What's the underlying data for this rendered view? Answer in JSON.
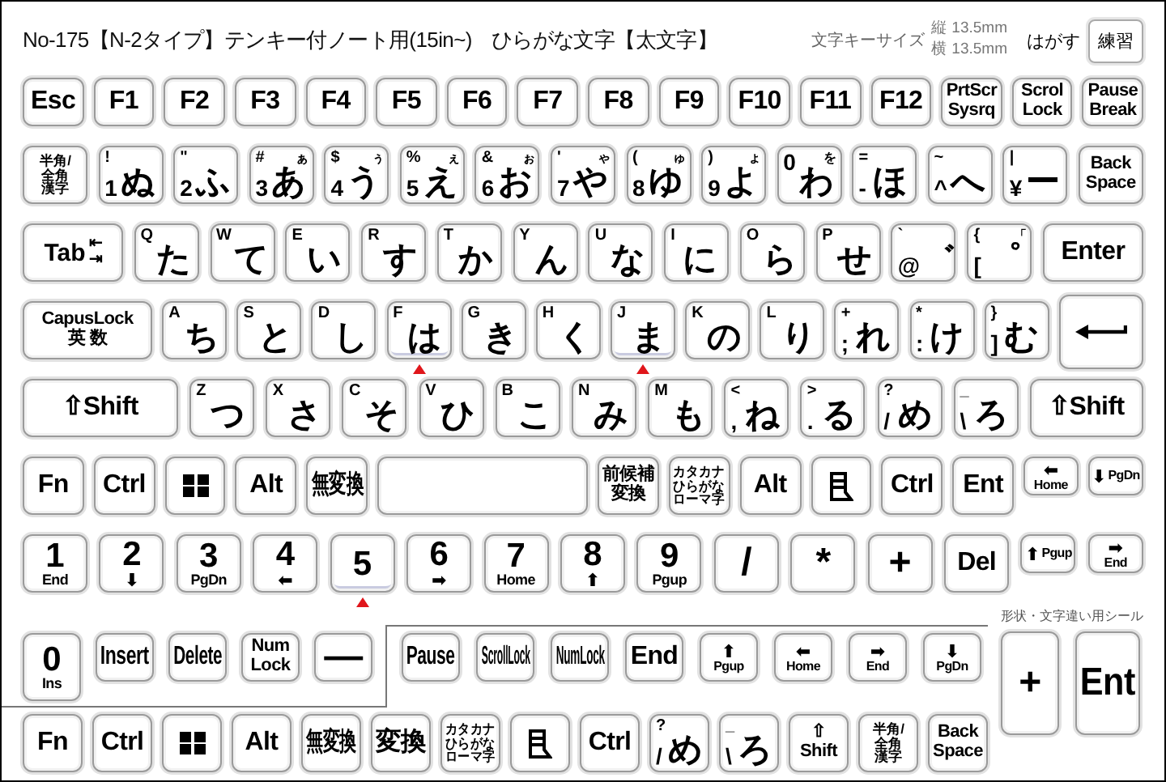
{
  "header": {
    "title": "No-175【N-2タイプ】テンキー付ノート用(15in~)",
    "subtitle": "ひらがな文字【太文字】",
    "size_label": "文字キーサイズ",
    "size_values": [
      "縦 13.5mm",
      "横 13.5mm"
    ],
    "peel_label": "はがす",
    "practice_tag": "練習"
  },
  "rows": [
    [
      {
        "kind": "text",
        "lines": [
          "Esc"
        ],
        "homing": false
      },
      {
        "kind": "text",
        "lines": [
          "F1"
        ],
        "homing": false
      },
      {
        "kind": "text",
        "lines": [
          "F2"
        ],
        "homing": false
      },
      {
        "kind": "text",
        "lines": [
          "F3"
        ],
        "homing": false
      },
      {
        "kind": "text",
        "lines": [
          "F4"
        ],
        "homing": false
      },
      {
        "kind": "text",
        "lines": [
          "F5"
        ],
        "homing": false
      },
      {
        "kind": "text",
        "lines": [
          "F6"
        ],
        "homing": false
      },
      {
        "kind": "text",
        "lines": [
          "F7"
        ],
        "homing": false
      },
      {
        "kind": "text",
        "lines": [
          "F8"
        ],
        "homing": false
      },
      {
        "kind": "text",
        "lines": [
          "F9"
        ],
        "homing": false
      },
      {
        "kind": "text",
        "lines": [
          "F10"
        ],
        "homing": false
      },
      {
        "kind": "text",
        "lines": [
          "F11"
        ],
        "homing": false
      },
      {
        "kind": "text",
        "lines": [
          "F12"
        ],
        "homing": false
      },
      {
        "kind": "text",
        "lines": [
          "PrtScr",
          "Sysrq"
        ],
        "homing": false
      },
      {
        "kind": "text",
        "lines": [
          "Scrol",
          "Lock"
        ],
        "homing": false
      },
      {
        "kind": "text",
        "lines": [
          "Pause",
          "Break"
        ],
        "homing": false
      }
    ],
    [
      {
        "kind": "text",
        "lines": [
          "半角/",
          "全角",
          "漢字"
        ],
        "homing": false
      },
      {
        "kind": "kana",
        "tl": "!",
        "bl": "1",
        "main": "ぬ",
        "homing": false
      },
      {
        "kind": "kana",
        "tl": "\"",
        "bl": "2",
        "main": "ふ",
        "homing": false
      },
      {
        "kind": "kana",
        "tl": "#",
        "bl": "3",
        "tr": "ぁ",
        "main": "あ",
        "homing": false
      },
      {
        "kind": "kana",
        "tl": "$",
        "bl": "4",
        "tr": "ぅ",
        "main": "う",
        "homing": false
      },
      {
        "kind": "kana",
        "tl": "%",
        "bl": "5",
        "tr": "ぇ",
        "main": "え",
        "homing": false
      },
      {
        "kind": "kana",
        "tl": "&",
        "bl": "6",
        "tr": "ぉ",
        "main": "お",
        "homing": false
      },
      {
        "kind": "kana",
        "tl": "'",
        "bl": "7",
        "tr": "ゃ",
        "main": "や",
        "homing": false
      },
      {
        "kind": "kana",
        "tl": "(",
        "bl": "8",
        "tr": "ゅ",
        "main": "ゆ",
        "homing": false
      },
      {
        "kind": "kana",
        "tl": ")",
        "bl": "9",
        "tr": "ょ",
        "main": "よ",
        "homing": false
      },
      {
        "kind": "kana",
        "bl": "0",
        "tr": "を",
        "main": "わ",
        "homing": false
      },
      {
        "kind": "kana",
        "tl": "=",
        "bl": "-",
        "main": "ほ",
        "homing": false
      },
      {
        "kind": "kana",
        "tl": "~",
        "bl": "^",
        "main": "へ",
        "homing": false
      },
      {
        "kind": "kana",
        "tl": "|",
        "bl": "¥",
        "main": "ー",
        "homing": false
      },
      {
        "kind": "text",
        "lines": [
          "Back",
          "Space"
        ],
        "homing": false
      }
    ],
    [
      {
        "kind": "tab",
        "main": "Tab",
        "tr": "⇤",
        "br": "⇥",
        "homing": false
      },
      {
        "kind": "kana",
        "tl": "Q",
        "main": "た",
        "homing": false
      },
      {
        "kind": "kana",
        "tl": "W",
        "main": "て",
        "homing": false
      },
      {
        "kind": "kana",
        "tl": "E",
        "main": "い",
        "homing": false
      },
      {
        "kind": "kana",
        "tl": "R",
        "main": "す",
        "homing": false
      },
      {
        "kind": "kana",
        "tl": "T",
        "main": "か",
        "homing": false
      },
      {
        "kind": "kana",
        "tl": "Y",
        "main": "ん",
        "homing": false
      },
      {
        "kind": "kana",
        "tl": "U",
        "main": "な",
        "homing": false
      },
      {
        "kind": "kana",
        "tl": "I",
        "main": "に",
        "homing": false
      },
      {
        "kind": "kana",
        "tl": "O",
        "main": "ら",
        "homing": false
      },
      {
        "kind": "kana",
        "tl": "P",
        "main": "せ",
        "homing": false
      },
      {
        "kind": "kana",
        "tl": "`",
        "bl": "@",
        "main": "゛",
        "homing": false
      },
      {
        "kind": "kana",
        "tl": "{",
        "bl": "[",
        "tr": "「",
        "main": "゜",
        "homing": false
      },
      {
        "kind": "text",
        "lines": [
          "Enter"
        ],
        "homing": false
      }
    ],
    [
      {
        "kind": "text",
        "lines": [
          "CapusLock",
          "英 数"
        ],
        "homing": false
      },
      {
        "kind": "kana",
        "tl": "A",
        "main": "ち",
        "homing": false
      },
      {
        "kind": "kana",
        "tl": "S",
        "main": "と",
        "homing": false
      },
      {
        "kind": "kana",
        "tl": "D",
        "main": "し",
        "homing": false
      },
      {
        "kind": "kana",
        "tl": "F",
        "main": "は",
        "homing": true
      },
      {
        "kind": "kana",
        "tl": "G",
        "main": "き",
        "homing": false
      },
      {
        "kind": "kana",
        "tl": "H",
        "main": "く",
        "homing": false
      },
      {
        "kind": "kana",
        "tl": "J",
        "main": "ま",
        "homing": true
      },
      {
        "kind": "kana",
        "tl": "K",
        "main": "の",
        "homing": false
      },
      {
        "kind": "kana",
        "tl": "L",
        "main": "り",
        "homing": false
      },
      {
        "kind": "kana",
        "tl": "+",
        "bl": ";",
        "main": "れ",
        "homing": false
      },
      {
        "kind": "kana",
        "tl": "*",
        "bl": ":",
        "main": "け",
        "homing": false
      },
      {
        "kind": "kana",
        "tl": "}",
        "bl": "]",
        "main": "む",
        "homing": false
      },
      {
        "kind": "return",
        "homing": false
      }
    ],
    [
      {
        "kind": "text",
        "lines": [
          "⇧Shift"
        ],
        "homing": false
      },
      {
        "kind": "kana",
        "tl": "Z",
        "main": "つ",
        "homing": false
      },
      {
        "kind": "kana",
        "tl": "X",
        "main": "さ",
        "homing": false
      },
      {
        "kind": "kana",
        "tl": "C",
        "main": "そ",
        "homing": false
      },
      {
        "kind": "kana",
        "tl": "V",
        "main": "ひ",
        "homing": false
      },
      {
        "kind": "kana",
        "tl": "B",
        "main": "こ",
        "homing": false
      },
      {
        "kind": "kana",
        "tl": "N",
        "main": "み",
        "homing": false
      },
      {
        "kind": "kana",
        "tl": "M",
        "main": "も",
        "homing": false
      },
      {
        "kind": "kana",
        "tl": "<",
        "bl": ",",
        "main": "ね",
        "homing": false
      },
      {
        "kind": "kana",
        "tl": ">",
        "bl": ".",
        "main": "る",
        "homing": false
      },
      {
        "kind": "kana",
        "tl": "?",
        "bl": "/",
        "main": "め",
        "homing": false
      },
      {
        "kind": "kana",
        "tl": "_",
        "bl": "\\",
        "main": "ろ",
        "homing": false
      },
      {
        "kind": "text",
        "lines": [
          "⇧Shift"
        ],
        "homing": false
      }
    ],
    [
      {
        "kind": "text",
        "lines": [
          "Fn"
        ],
        "homing": false
      },
      {
        "kind": "text",
        "lines": [
          "Ctrl"
        ],
        "homing": false
      },
      {
        "kind": "windows",
        "homing": false
      },
      {
        "kind": "text",
        "lines": [
          "Alt"
        ],
        "homing": false
      },
      {
        "kind": "text",
        "lines": [
          "無変換"
        ],
        "homing": false
      },
      {
        "kind": "blank",
        "homing": false
      },
      {
        "kind": "text",
        "lines": [
          "前候補",
          "変換"
        ],
        "homing": false
      },
      {
        "kind": "text",
        "lines": [
          "カタカナ",
          "ひらがな",
          "ローマ字"
        ],
        "homing": false
      },
      {
        "kind": "text",
        "lines": [
          "Alt"
        ],
        "homing": false
      },
      {
        "kind": "menu",
        "homing": false
      },
      {
        "kind": "text",
        "lines": [
          "Ctrl"
        ],
        "homing": false
      },
      {
        "kind": "text",
        "lines": [
          "Ent"
        ],
        "homing": false
      },
      {
        "kind": "arrow",
        "arrow": "⬅",
        "label": "Home",
        "homing": false
      },
      {
        "kind": "arrowrow",
        "arrow": "⬇",
        "label": "PgDn",
        "homing": false
      }
    ],
    [
      {
        "kind": "num",
        "main": "1",
        "sub": "End",
        "homing": false
      },
      {
        "kind": "num",
        "main": "2",
        "arrow": "⬇",
        "homing": false
      },
      {
        "kind": "num",
        "main": "3",
        "sub": "PgDn",
        "homing": false
      },
      {
        "kind": "num",
        "main": "4",
        "arrow": "⬅",
        "homing": false
      },
      {
        "kind": "num",
        "main": "5",
        "homing": true
      },
      {
        "kind": "num",
        "main": "6",
        "arrow": "➡",
        "homing": false
      },
      {
        "kind": "num",
        "main": "7",
        "sub": "Home",
        "homing": false
      },
      {
        "kind": "num",
        "main": "8",
        "arrow": "⬆",
        "homing": false
      },
      {
        "kind": "num",
        "main": "9",
        "sub": "Pgup",
        "homing": false
      },
      {
        "kind": "text",
        "lines": [
          "/"
        ],
        "homing": false
      },
      {
        "kind": "text",
        "lines": [
          "*"
        ],
        "homing": false
      },
      {
        "kind": "text",
        "lines": [
          "+"
        ],
        "homing": false
      },
      {
        "kind": "text",
        "lines": [
          "Del"
        ],
        "homing": false
      },
      {
        "kind": "arrowrow",
        "arrow": "⬆",
        "label": "Pgup",
        "homing": false
      },
      {
        "kind": "arrow",
        "arrow": "➡",
        "label": "End",
        "homing": false
      }
    ]
  ],
  "cut_block": {
    "inner_keys": [
      {
        "kind": "num",
        "main": "0",
        "sub": "Ins",
        "homing": false
      },
      {
        "kind": "text",
        "lines": [
          "Insert"
        ],
        "homing": false
      },
      {
        "kind": "text",
        "lines": [
          "Delete"
        ],
        "homing": false
      },
      {
        "kind": "text",
        "lines": [
          "Num",
          "Lock"
        ],
        "homing": false
      },
      {
        "kind": "text",
        "lines": [
          "—"
        ],
        "homing": false
      }
    ],
    "outer_keys": [
      {
        "kind": "text",
        "lines": [
          "Pause"
        ],
        "homing": false
      },
      {
        "kind": "text",
        "lines": [
          "ScrollLock"
        ],
        "homing": false
      },
      {
        "kind": "text",
        "lines": [
          "NumLock"
        ],
        "homing": false
      },
      {
        "kind": "text",
        "lines": [
          "End"
        ],
        "homing": false
      },
      {
        "kind": "arrow",
        "arrow": "⬆",
        "label": "Pgup",
        "homing": false
      },
      {
        "kind": "arrow",
        "arrow": "⬅",
        "label": "Home",
        "homing": false
      },
      {
        "kind": "arrow",
        "arrow": "➡",
        "label": "End",
        "homing": false
      },
      {
        "kind": "arrow",
        "arrow": "⬇",
        "label": "PgDn",
        "homing": false
      }
    ],
    "caption": "形状・文字違い用シール",
    "tall_keys": [
      {
        "kind": "text",
        "lines": [
          "+"
        ],
        "homing": false
      },
      {
        "kind": "text",
        "lines": [
          "Ent"
        ],
        "homing": false
      }
    ]
  },
  "bottom_row": [
    {
      "kind": "text",
      "lines": [
        "Fn"
      ],
      "homing": false
    },
    {
      "kind": "text",
      "lines": [
        "Ctrl"
      ],
      "homing": false
    },
    {
      "kind": "windows",
      "homing": false
    },
    {
      "kind": "text",
      "lines": [
        "Alt"
      ],
      "homing": false
    },
    {
      "kind": "text",
      "lines": [
        "無変換"
      ],
      "homing": false
    },
    {
      "kind": "text",
      "lines": [
        "変換"
      ],
      "homing": false
    },
    {
      "kind": "text",
      "lines": [
        "カタカナ",
        "ひらがな",
        "ローマ字"
      ],
      "homing": false
    },
    {
      "kind": "menu",
      "homing": false
    },
    {
      "kind": "text",
      "lines": [
        "Ctrl"
      ],
      "homing": false
    },
    {
      "kind": "kana",
      "tl": "?",
      "bl": "/",
      "main": "め",
      "homing": false
    },
    {
      "kind": "kana",
      "tl": "_",
      "bl": "\\",
      "main": "ろ",
      "homing": false
    },
    {
      "kind": "text",
      "lines": [
        "⇧",
        "Shift"
      ],
      "homing": false
    },
    {
      "kind": "text",
      "lines": [
        "半角/",
        "全角",
        "漢字"
      ],
      "homing": false
    },
    {
      "kind": "text",
      "lines": [
        "Back",
        "Space"
      ],
      "homing": false
    }
  ]
}
